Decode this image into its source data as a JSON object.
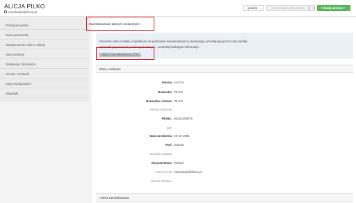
{
  "header": {
    "user_name": "ALICJA PILKO",
    "user_email": "mmchalak@ifirma.pl"
  },
  "toolbar": {
    "back_label": "‹ powrót",
    "change_label": "☐ zmień dane pracownika",
    "dropdown_label": "▾",
    "add_label": "+ dodaj umowę ▾"
  },
  "sidebar": {
    "items": [
      {
        "label": "Profil pracownika"
      },
      {
        "label": "Dane pracownika"
      },
      {
        "label": "Ubezpieczenie osób z rodziny"
      },
      {
        "label": "Akta osobowe"
      },
      {
        "label": "Deklaracje i formularze"
      },
      {
        "label": "Umowy i rachunki"
      },
      {
        "label": "Karty wynagrodzeń"
      },
      {
        "label": "Statystyki"
      }
    ]
  },
  "main": {
    "questionnaire_title": "Kwestionariusz danych osobowych",
    "info_line1": "Poniższe dane zostały uzupełnione na podstawie kwestionariusza osobowego przesłanego przez pracownika.",
    "info_line2": "Sprawdź poprawność poniższych danych i uzupełnij brakujące informacje.",
    "download_link": "Pobierz kwestionariusz (PDF)",
    "section_personal": "Dane osobowe",
    "section_address": "Adres zameldowania",
    "fields": [
      {
        "label": "Imiona",
        "value": "ALICJA",
        "bold": true
      },
      {
        "label": "Nazwisko",
        "value": "PILKO",
        "bold": true
      },
      {
        "label": "Nazwisko rodowe",
        "value": "PILKO",
        "bold": true
      },
      {
        "label": "Imiona rodziców",
        "value": "",
        "bold": false
      },
      {
        "label": "PESEL",
        "value": "86120309975",
        "bold": true
      },
      {
        "label": "NIP",
        "value": "",
        "bold": false
      },
      {
        "label": "Data urodzenia",
        "value": "03-10-1986",
        "bold": true
      },
      {
        "label": "Płeć",
        "value": "kobieta",
        "bold": true
      },
      {
        "label": "Dowód osobisty",
        "value": "",
        "bold": false
      },
      {
        "label": "Obywatelstwo",
        "value": "Polskie",
        "bold": true
      },
      {
        "label": "Adres e-mail",
        "value": "mmchalak@ifirma.pl",
        "bold": false
      },
      {
        "label": "Numer telefonu",
        "value": "",
        "bold": false
      }
    ]
  }
}
